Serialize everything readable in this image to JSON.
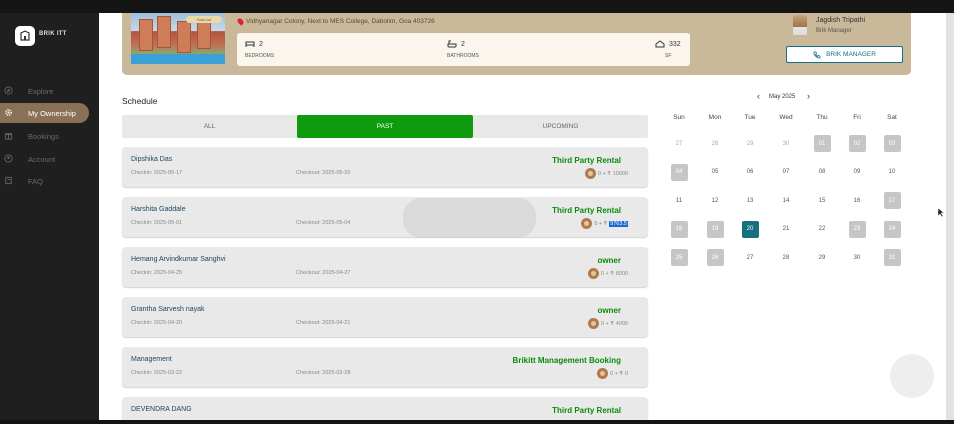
{
  "brand": {
    "name": "BRIK ITT"
  },
  "nav": [
    {
      "label": "Explore",
      "icon": "compass-icon",
      "active": false
    },
    {
      "label": "My Ownership",
      "icon": "gear-icon",
      "active": true
    },
    {
      "label": "Bookings",
      "icon": "gift-icon",
      "active": false
    },
    {
      "label": "Account",
      "icon": "user-icon",
      "active": false
    },
    {
      "label": "FAQ",
      "icon": "book-icon",
      "active": false
    }
  ],
  "property": {
    "badge": "Sold out",
    "address": "Vidhyanagar Colony, Next to MES College, Dabolim, Goa 403726",
    "bedrooms": {
      "value": "2",
      "label": "BEDROOMS"
    },
    "bathrooms": {
      "value": "2",
      "label": "BATHROOMS"
    },
    "area": {
      "value": "332",
      "label": "SF"
    }
  },
  "manager": {
    "name": "Jagdish Tripathi",
    "role": "Brik Manager",
    "button": "BRIK MANAGER"
  },
  "schedule": {
    "title": "Schedule",
    "tabs": [
      {
        "label": "ALL",
        "active": false
      },
      {
        "label": "PAST",
        "active": true
      },
      {
        "label": "UPCOMING",
        "active": false
      }
    ],
    "bookings": [
      {
        "name": "Dipshika Das",
        "checkin": "Checkin: 2025-05-17",
        "checkout": "Checkout: 2025-05-20",
        "type": "Third Party Rental",
        "pay_prefix": "0 + ₹ ",
        "pay_amount": "10000",
        "highlight": false
      },
      {
        "name": "Harshita Gaddale",
        "checkin": "Checkin: 2025-05-01",
        "checkout": "Checkout: 2025-05-04",
        "type": "Third Party Rental",
        "pay_prefix": "0 + ₹ ",
        "pay_amount": "9763.5",
        "highlight": true
      },
      {
        "name": "Hemang Arvindkumar Sanghvi",
        "checkin": "Checkin: 2025-04-25",
        "checkout": "Checkout: 2025-04-27",
        "type": "owner",
        "pay_prefix": "0 + ₹ ",
        "pay_amount": "8000",
        "highlight": false
      },
      {
        "name": "Grantha Sarvesh nayak",
        "checkin": "Checkin: 2025-04-20",
        "checkout": "Checkout: 2025-04-21",
        "type": "owner",
        "pay_prefix": "0 + ₹ ",
        "pay_amount": "4000",
        "highlight": false
      },
      {
        "name": "Management",
        "checkin": "Checkin: 2025-03-22",
        "checkout": "Checkout: 2025-03-28",
        "type": "Brikitt Management Booking",
        "pay_prefix": "0 + ₹ ",
        "pay_amount": "0",
        "highlight": false
      },
      {
        "name": "DEVENDRA DANG",
        "checkin": "",
        "checkout": "",
        "type": "Third Party Rental",
        "pay_prefix": "",
        "pay_amount": "",
        "highlight": false
      }
    ]
  },
  "calendar": {
    "month": "May 2025",
    "weekdays": [
      "Sun",
      "Mon",
      "Tue",
      "Wed",
      "Thu",
      "Fri",
      "Sat"
    ],
    "weeks": [
      [
        {
          "d": "27",
          "s": "fade"
        },
        {
          "d": "28",
          "s": "fade"
        },
        {
          "d": "29",
          "s": "fade"
        },
        {
          "d": "30",
          "s": "fade"
        },
        {
          "d": "01",
          "s": "dis"
        },
        {
          "d": "02",
          "s": "dis"
        },
        {
          "d": "03",
          "s": "dis"
        }
      ],
      [
        {
          "d": "04",
          "s": "dis"
        },
        {
          "d": "05",
          "s": ""
        },
        {
          "d": "06",
          "s": ""
        },
        {
          "d": "07",
          "s": ""
        },
        {
          "d": "08",
          "s": ""
        },
        {
          "d": "09",
          "s": ""
        },
        {
          "d": "10",
          "s": ""
        }
      ],
      [
        {
          "d": "11",
          "s": ""
        },
        {
          "d": "12",
          "s": ""
        },
        {
          "d": "13",
          "s": ""
        },
        {
          "d": "14",
          "s": ""
        },
        {
          "d": "15",
          "s": ""
        },
        {
          "d": "16",
          "s": ""
        },
        {
          "d": "17",
          "s": "dis"
        }
      ],
      [
        {
          "d": "18",
          "s": "dis"
        },
        {
          "d": "19",
          "s": "dis"
        },
        {
          "d": "20",
          "s": "today"
        },
        {
          "d": "21",
          "s": ""
        },
        {
          "d": "22",
          "s": ""
        },
        {
          "d": "23",
          "s": "dis"
        },
        {
          "d": "24",
          "s": "dis"
        }
      ],
      [
        {
          "d": "25",
          "s": "dis"
        },
        {
          "d": "26",
          "s": "dis"
        },
        {
          "d": "27",
          "s": ""
        },
        {
          "d": "28",
          "s": ""
        },
        {
          "d": "29",
          "s": ""
        },
        {
          "d": "30",
          "s": ""
        },
        {
          "d": "31",
          "s": "dis"
        }
      ]
    ]
  },
  "colors": {
    "accent": "#8a7055",
    "green": "#0e9c0e",
    "teal": "#16707d"
  }
}
